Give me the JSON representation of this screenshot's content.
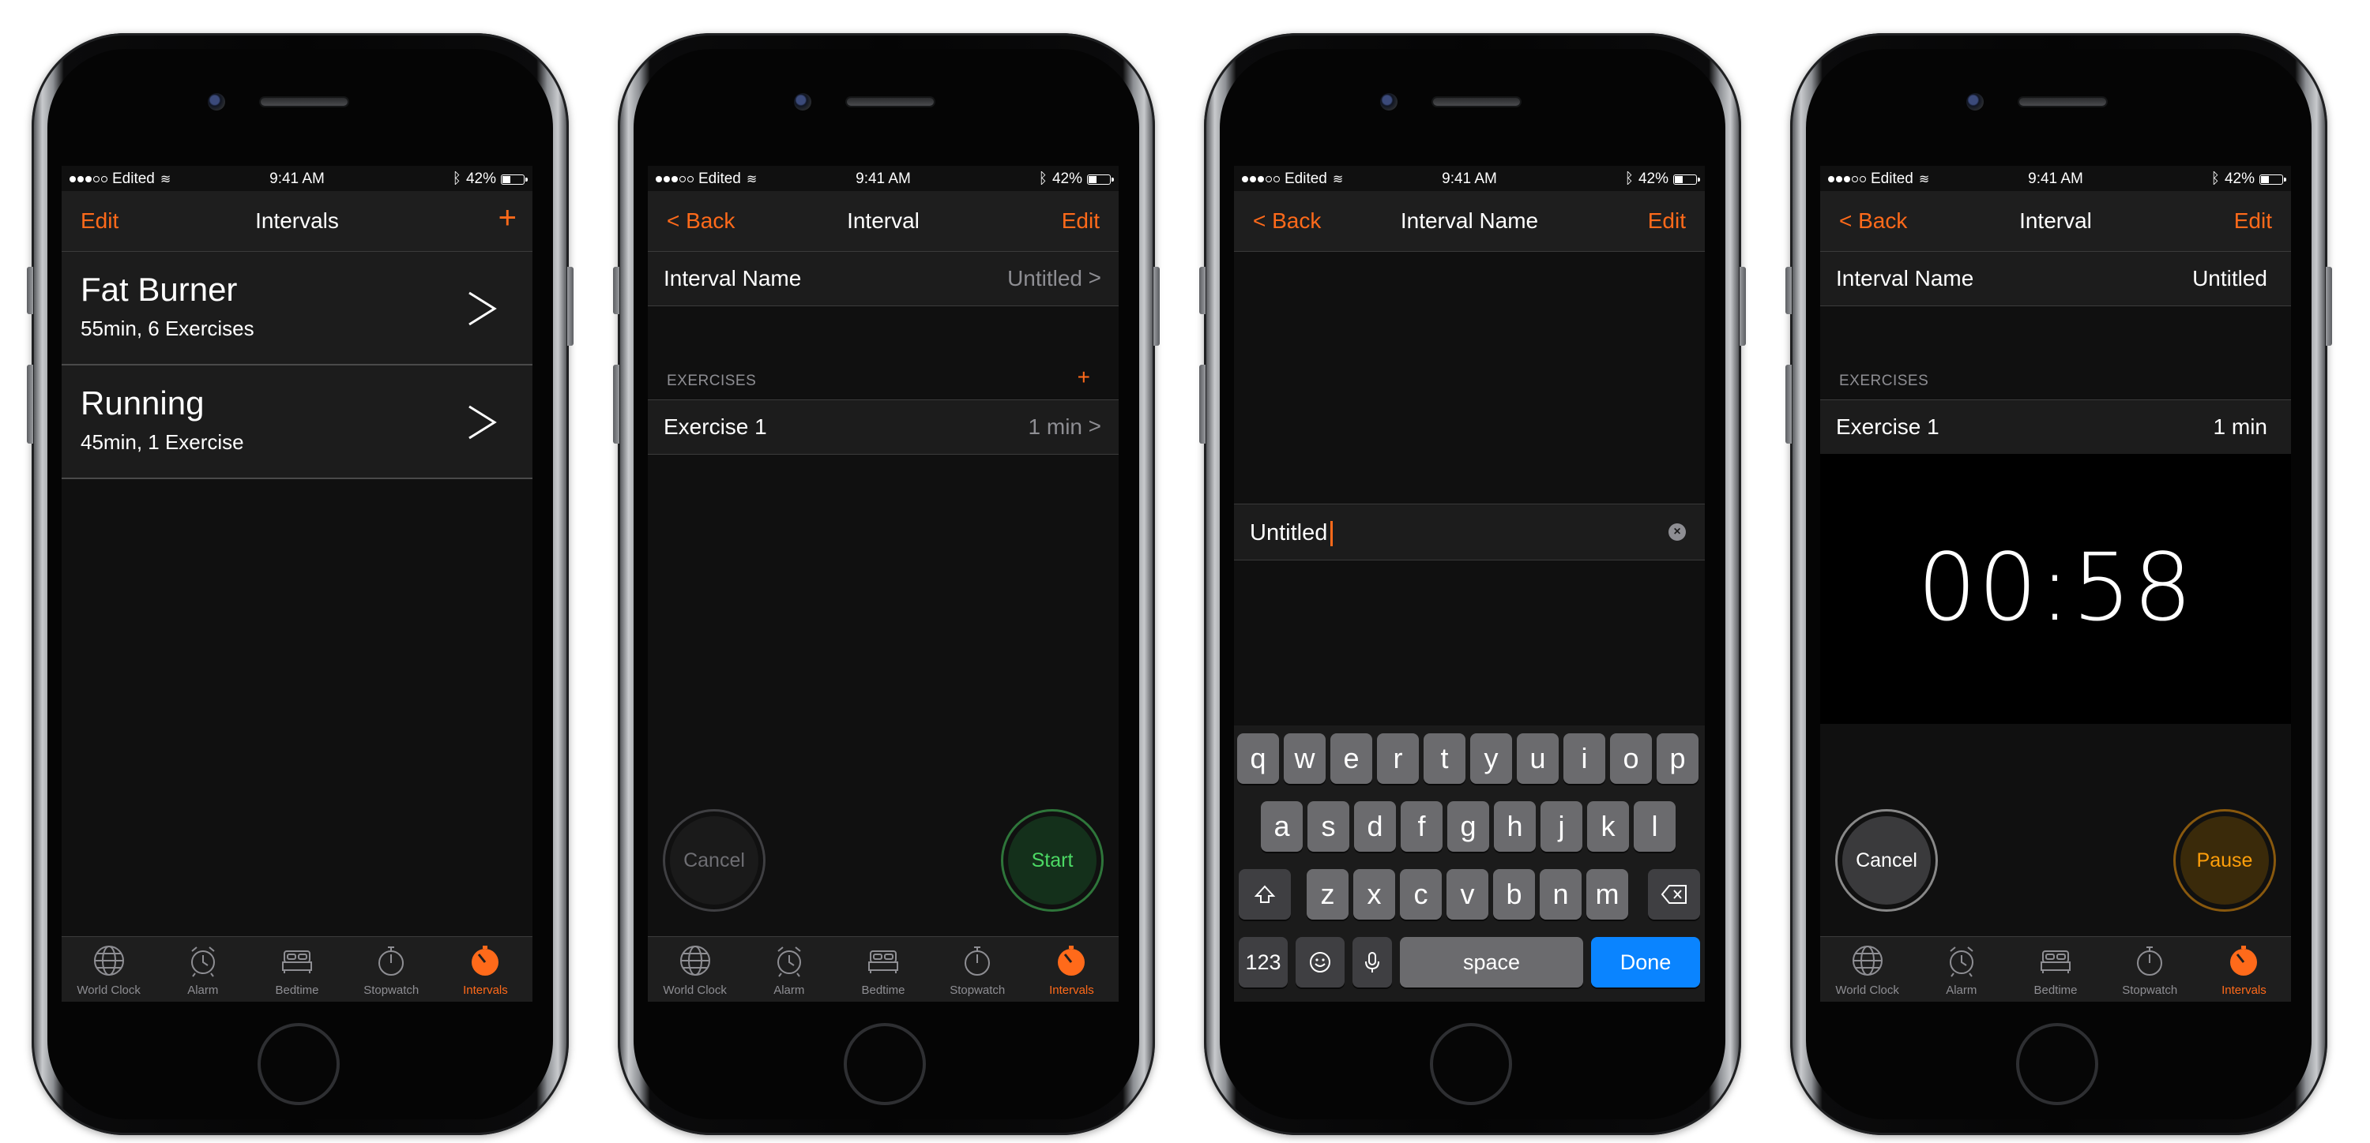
{
  "status_bar": {
    "carrier": "Edited",
    "time": "9:41 AM",
    "battery": "42%",
    "battery_level": 0.42
  },
  "tabs": [
    "World Clock",
    "Alarm",
    "Bedtime",
    "Stopwatch",
    "Intervals"
  ],
  "screen1": {
    "nav": {
      "left": "Edit",
      "title": "Intervals",
      "right": "+"
    },
    "rows": [
      {
        "title": "Fat Burner",
        "subtitle": "55min, 6 Exercises"
      },
      {
        "title": "Running",
        "subtitle": "45min, 1 Exercise"
      }
    ]
  },
  "screen2": {
    "nav": {
      "left": "< Back",
      "title": "Interval",
      "right": "Edit"
    },
    "name_row": {
      "label": "Interval Name",
      "value": "Untitled",
      "chevron": ">"
    },
    "section": {
      "header": "EXERCISES",
      "add": "+"
    },
    "exercise_row": {
      "label": "Exercise 1",
      "value": "1 min",
      "chevron": ">"
    },
    "cancel": "Cancel",
    "start": "Start"
  },
  "screen3": {
    "nav": {
      "left": "< Back",
      "title": "Interval Name",
      "right": "Edit"
    },
    "input_value": "Untitled",
    "keyboard": {
      "row1": [
        "q",
        "w",
        "e",
        "r",
        "t",
        "y",
        "u",
        "i",
        "o",
        "p"
      ],
      "row2": [
        "a",
        "s",
        "d",
        "f",
        "g",
        "h",
        "j",
        "k",
        "l"
      ],
      "row3": [
        "z",
        "x",
        "c",
        "v",
        "b",
        "n",
        "m"
      ],
      "numbers": "123",
      "space": "space",
      "done": "Done"
    }
  },
  "screen4": {
    "nav": {
      "left": "< Back",
      "title": "Interval",
      "right": "Edit"
    },
    "name_row": {
      "label": "Interval Name",
      "value": "Untitled"
    },
    "section": {
      "header": "EXERCISES"
    },
    "exercise_row": {
      "label": "Exercise 1",
      "value": "1 min"
    },
    "timer": "00:58",
    "cancel": "Cancel",
    "pause": "Pause"
  },
  "colors": {
    "accent": "#ff6a1a",
    "start_green": "#4cd964",
    "pause_amber": "#ff9f0a",
    "keyboard_done": "#0a84ff"
  }
}
